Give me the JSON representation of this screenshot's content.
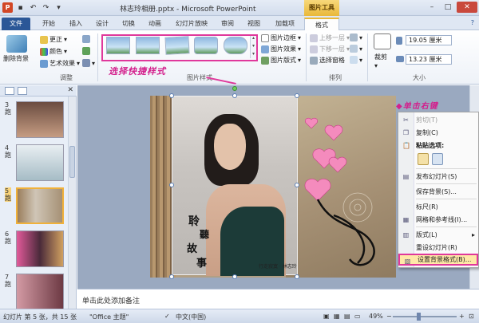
{
  "window": {
    "title": "林志玲相册.pptx - Microsoft PowerPoint",
    "context_tab": "图片工具",
    "minimize": "–",
    "maximize": "□",
    "close": "✕"
  },
  "tabs": [
    "文件",
    "开始",
    "插入",
    "设计",
    "切换",
    "动画",
    "幻灯片放映",
    "审阅",
    "视图",
    "加载项",
    "格式"
  ],
  "ribbon": {
    "remove_bg": "删除背景",
    "adjust": {
      "corrections": "更正",
      "color": "颜色",
      "artistic": "艺术效果",
      "label": "调整"
    },
    "styles_label": "图片样式",
    "picture_border": "图片边框",
    "picture_effects": "图片效果",
    "picture_layout": "图片版式",
    "arrange": {
      "bring_forward": "上移一层",
      "send_backward": "下移一层",
      "selection_pane": "选择窗格",
      "label": "排列"
    },
    "size": {
      "crop": "裁剪",
      "height": "19.05 厘米",
      "width": "13.23 厘米",
      "label": "大小"
    }
  },
  "annotations": {
    "quick_style": "选择快捷样式",
    "right_click": "◆单击右键"
  },
  "slides": [
    {
      "num": "3",
      "sub": "跑"
    },
    {
      "num": "4",
      "sub": "跑"
    },
    {
      "num": "5",
      "sub": "跑",
      "selected": true
    },
    {
      "num": "6",
      "sub": "跑"
    },
    {
      "num": "7",
      "sub": "跑"
    }
  ],
  "slide_content": {
    "calligraphy_1": "聆",
    "calligraphy_2": "聽",
    "calligraphy_3": "故",
    "calligraphy_4": "事",
    "signature": "行走寂寞 · 林志玲"
  },
  "notes_placeholder": "单击此处添加备注",
  "context_menu": {
    "cut": "剪切(T)",
    "copy": "复制(C)",
    "paste_options": "粘贴选项:",
    "publish": "发布幻灯片(S)",
    "save_background": "保存背景(S)...",
    "ruler": "标尺(R)",
    "grid": "网格和参考线(I)...",
    "layout": "版式(L)",
    "reset": "重设幻灯片(R)",
    "format_background": "设置背景格式(B)..."
  },
  "status": {
    "slide_info": "幻灯片 第 5 张，共 15 张",
    "theme": "\"Office 主题\"",
    "language": "中文(中国)",
    "zoom": "49%"
  },
  "colors": {
    "accent_pink": "#e0389b",
    "file_tab": "#2b5797",
    "context_tab": "#e9b83a"
  }
}
